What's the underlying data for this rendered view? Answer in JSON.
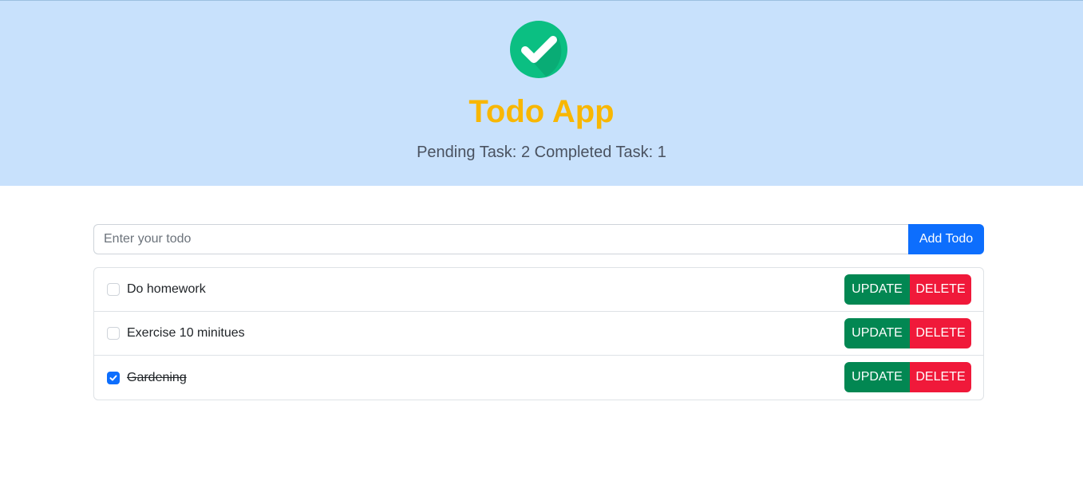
{
  "header": {
    "logo_icon": "check-circle-icon",
    "title": "Todo App",
    "pending_label": "Pending Task:",
    "pending_count": "2",
    "completed_label": "Completed Task:",
    "completed_count": "1",
    "title_color": "#f8b703",
    "background_color": "#c8e1fc"
  },
  "form": {
    "placeholder": "Enter your todo",
    "value": "",
    "add_button_label": "Add Todo"
  },
  "todos": [
    {
      "text": "Do homework",
      "completed": false,
      "update_label": "UPDATE",
      "delete_label": "DELETE"
    },
    {
      "text": "Exercise 10 minitues",
      "completed": false,
      "update_label": "UPDATE",
      "delete_label": "DELETE"
    },
    {
      "text": "Gardening",
      "completed": true,
      "update_label": "UPDATE",
      "delete_label": "DELETE"
    }
  ],
  "colors": {
    "primary": "#0d6efd",
    "update": "#028752",
    "delete": "#f0193a",
    "logo_green": "#0bbf82"
  }
}
